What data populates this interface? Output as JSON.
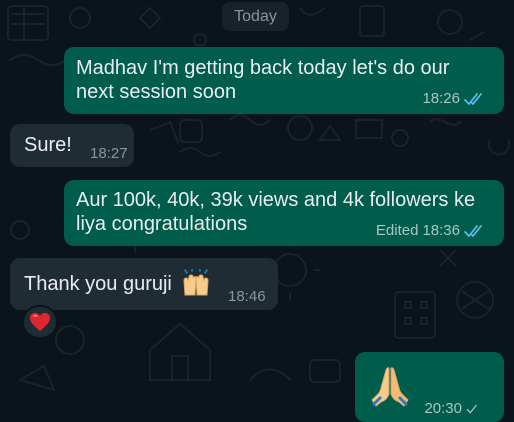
{
  "chat": {
    "date_chip": "Today",
    "messages": [
      {
        "direction": "outgoing",
        "lines": [
          "Madhav I'm getting back today let's do our",
          "next session soon"
        ],
        "time": "18:26",
        "status": "read"
      },
      {
        "direction": "incoming",
        "text": "Sure!",
        "time": "18:27"
      },
      {
        "direction": "outgoing",
        "lines": [
          "Aur 100k, 40k, 39k views and 4k followers ke",
          "liya congratulations"
        ],
        "edited": "Edited",
        "time": "18:36",
        "status": "read"
      },
      {
        "direction": "incoming",
        "text": "Thank you guruji",
        "emoji": "raising-hands-emoji",
        "time": "18:46",
        "reaction": "red-heart-emoji"
      },
      {
        "direction": "outgoing",
        "emoji": "folded-hands-emoji",
        "time": "20:30",
        "status": "delivered"
      }
    ]
  },
  "colors": {
    "background": "#0b141a",
    "outgoing_bubble": "#005c4b",
    "incoming_bubble": "#202c33",
    "read_tick": "#53bdeb",
    "text": "#e9edef",
    "meta_text": "#8696a0"
  }
}
